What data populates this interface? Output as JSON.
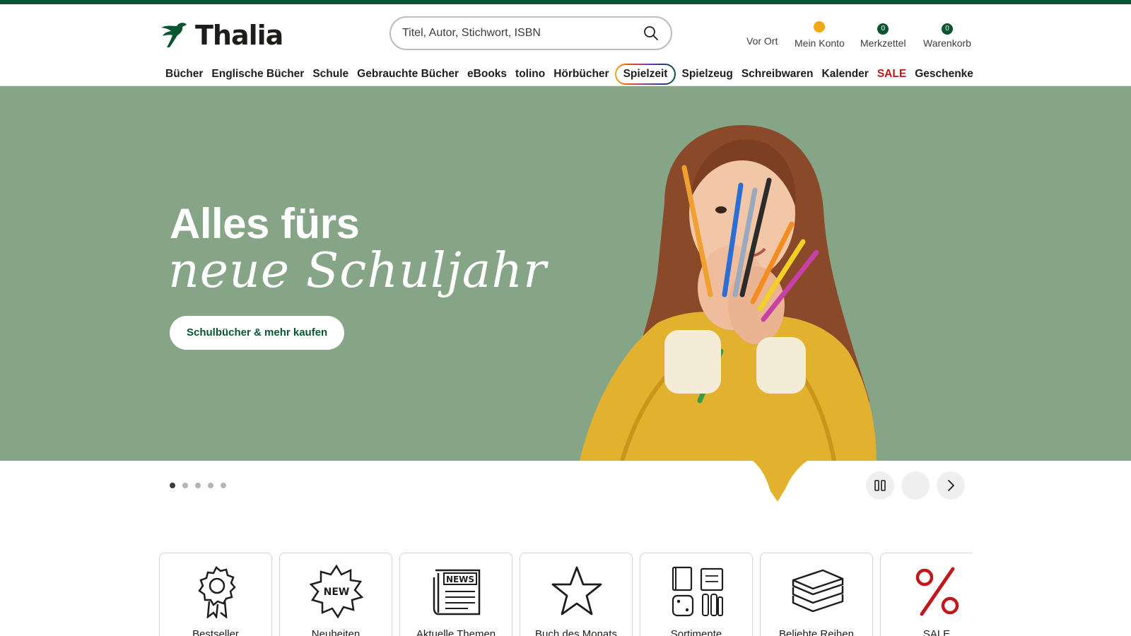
{
  "brand": {
    "name": "Thalia",
    "accent": "#0a5531",
    "hero_bg": "#86a486",
    "sale_color": "#c0171d"
  },
  "search": {
    "placeholder": "Titel, Autor, Stichwort, ISBN"
  },
  "actions": {
    "vor_ort": "Vor Ort",
    "mein_konto": "Mein Konto",
    "merkzettel": "Merkzettel",
    "merkzettel_count": "0",
    "warenkorb": "Warenkorb",
    "warenkorb_count": "0"
  },
  "nav": [
    "Bücher",
    "Englische Bücher",
    "Schule",
    "Gebrauchte Bücher",
    "eBooks",
    "tolino",
    "Hörbücher",
    "Spielzeit",
    "Spielzeug",
    "Schreibwaren",
    "Kalender",
    "SALE",
    "Geschenke"
  ],
  "hero": {
    "title_line1": "Alles fürs",
    "title_line2": "neue Schuljahr",
    "cta": "Schulbücher & mehr kaufen",
    "slide_count": 5,
    "active_slide": 1
  },
  "tiles": [
    {
      "label": "Bestseller",
      "icon": "award-ribbon-icon"
    },
    {
      "label": "Neuheiten",
      "icon": "new-badge-icon"
    },
    {
      "label": "Aktuelle Themen",
      "icon": "newspaper-icon"
    },
    {
      "label": "Buch des Monats",
      "icon": "star-icon"
    },
    {
      "label": "Sortimente",
      "icon": "assortment-icon"
    },
    {
      "label": "Beliebte Reihen",
      "icon": "book-stack-icon"
    },
    {
      "label": "SALE",
      "icon": "percent-icon"
    }
  ]
}
